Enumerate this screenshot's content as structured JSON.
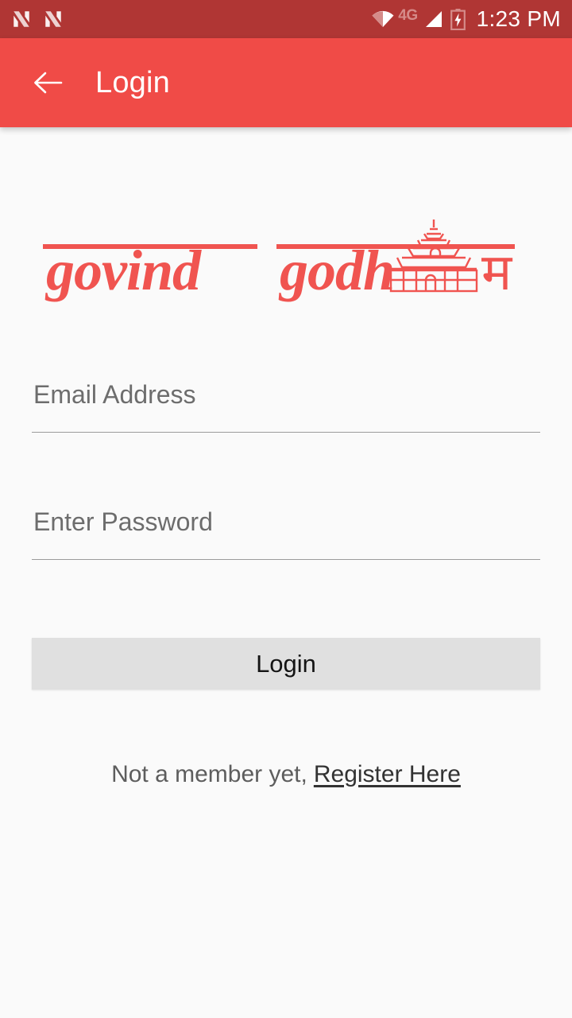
{
  "status_bar": {
    "background_color": "#b03634",
    "notification_icons": [
      "n-logo-icon",
      "n-logo-icon"
    ],
    "wifi_icon": "wifi-icon",
    "network_label": "4G",
    "signal_icon": "signal-bars-icon",
    "battery_icon": "battery-charging-icon",
    "clock": "1:23 PM"
  },
  "app_bar": {
    "background_color": "#f04b47",
    "back_icon": "arrow-back-icon",
    "title": "Login"
  },
  "logo": {
    "text": "govind godham",
    "word_one": "govind",
    "word_two": "godh",
    "word_two_suffix": "म",
    "graphic": "temple-icon",
    "color": "#f05450"
  },
  "form": {
    "email": {
      "label": "Email Address",
      "placeholder": "Email Address",
      "value": ""
    },
    "password": {
      "label": "Enter Password",
      "placeholder": "Enter Password",
      "value": ""
    },
    "submit_label": "Login",
    "submit_color": "#e0e0e0"
  },
  "register": {
    "prefix": "Not a member yet,",
    "link_label": "Register Here"
  },
  "page": {
    "background_color": "#fafafa"
  }
}
